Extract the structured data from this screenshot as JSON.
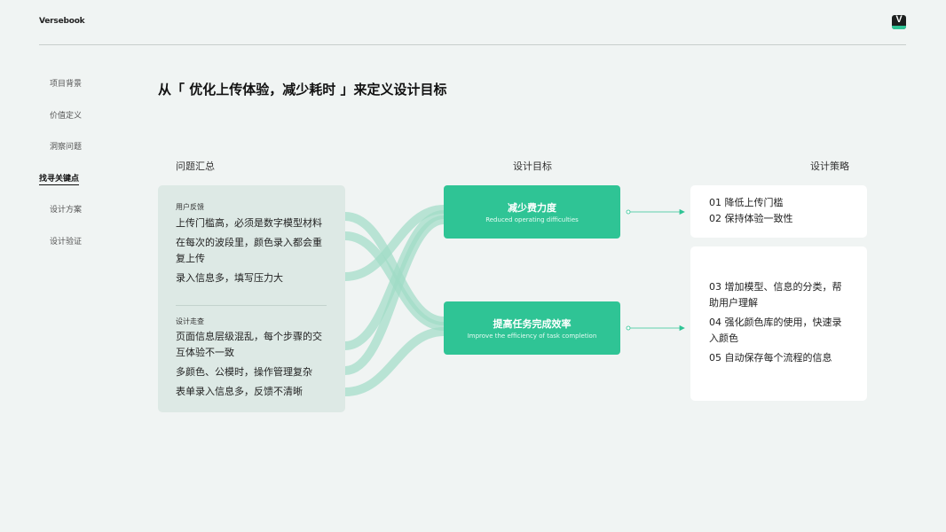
{
  "brand": "Versebook",
  "logo_letter": "V",
  "nav": {
    "items": [
      {
        "label": "项目背景"
      },
      {
        "label": "价值定义"
      },
      {
        "label": "洞察问题"
      },
      {
        "label": "找寻关键点"
      },
      {
        "label": "设计方案"
      },
      {
        "label": "设计验证"
      }
    ],
    "active_index": 3
  },
  "title": "从「 优化上传体验，减少耗时 」来定义设计目标",
  "columns": {
    "problems": "问题汇总",
    "goals": "设计目标",
    "strategy": "设计策略"
  },
  "problems": {
    "groups": [
      {
        "title": "用户反馈",
        "items": [
          "上传门槛高，必须是数字模型材料",
          "在每次的波段里，颜色录入都会重复上传",
          "录入信息多，填写压力大"
        ]
      },
      {
        "title": "设计走查",
        "items": [
          "页面信息层级混乱，每个步骤的交互体验不一致",
          "多颜色、公模时，操作管理复杂",
          "表单录入信息多，反馈不清晰"
        ]
      }
    ]
  },
  "goals": [
    {
      "title": "减少费力度",
      "subtitle": "Reduced operating difficulties"
    },
    {
      "title": "提高任务完成效率",
      "subtitle": "Improve the efficiency of task completion"
    }
  ],
  "strategies": [
    {
      "items": [
        "01 降低上传门槛",
        "02 保持体验一致性"
      ]
    },
    {
      "items": [
        "03 增加模型、信息的分类，帮助用户理解",
        "04 强化颜色库的使用，快速录入颜色",
        "05 自动保存每个流程的信息"
      ]
    }
  ],
  "colors": {
    "accent": "#2fc495",
    "flow": "#9fdcc6",
    "panel": "#dde9e5",
    "background": "#f0f4f3"
  }
}
